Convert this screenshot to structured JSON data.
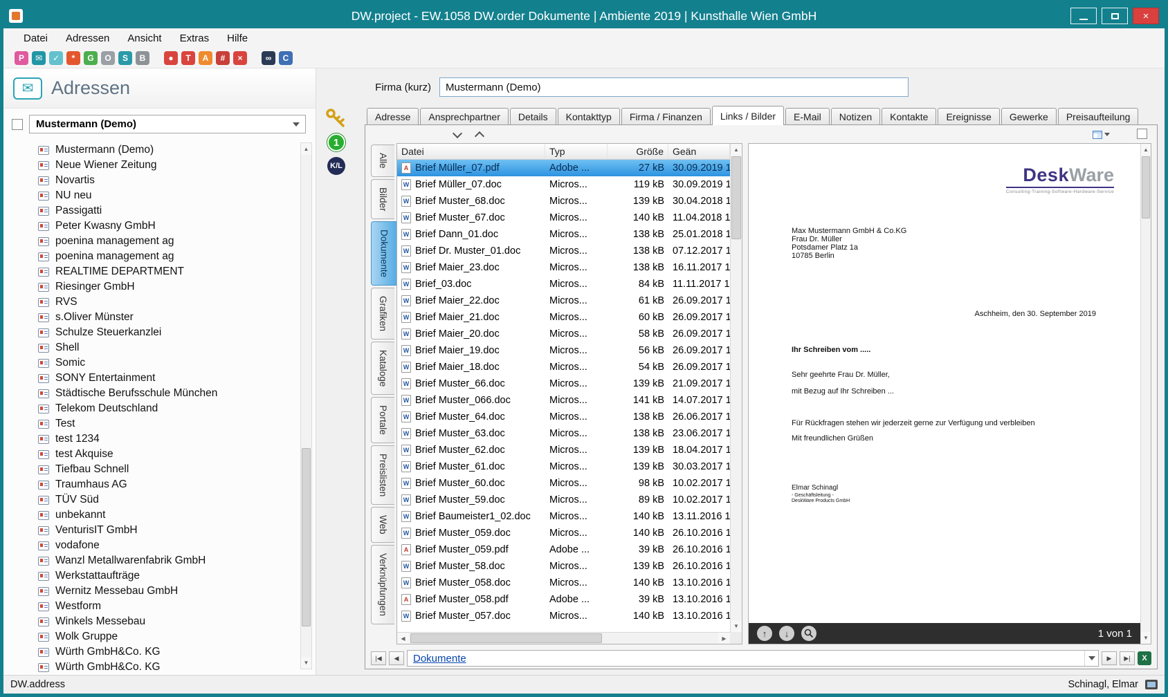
{
  "window": {
    "title": "DW.project - EW.1058 DW.order Dokumente | Ambiente 2019 | Kunsthalle Wien GmbH",
    "close_glyph": "×"
  },
  "menubar": {
    "items": [
      "Datei",
      "Adressen",
      "Ansicht",
      "Extras",
      "Hilfe"
    ]
  },
  "toolbar": {
    "icons": [
      {
        "name": "person-card-icon",
        "bg": "#df5a9e",
        "glyph": "P",
        "gap": false
      },
      {
        "name": "envelope-icon",
        "bg": "#2196a6",
        "glyph": "✉",
        "gap": false
      },
      {
        "name": "mail-check-icon",
        "bg": "#63c1cd",
        "glyph": "✓",
        "gap": false
      },
      {
        "name": "star-icon",
        "bg": "#e4572e",
        "glyph": "*",
        "gap": false
      },
      {
        "name": "plant-icon",
        "bg": "#4cae4f",
        "glyph": "G",
        "gap": false
      },
      {
        "name": "camera-icon",
        "bg": "#9aa0a6",
        "glyph": "O",
        "gap": false
      },
      {
        "name": "shield-icon",
        "bg": "#2a9aa8",
        "glyph": "S",
        "gap": false
      },
      {
        "name": "archive-icon",
        "bg": "#8d9297",
        "glyph": "B",
        "gap": false
      },
      {
        "name": "record-icon",
        "bg": "#d8453e",
        "glyph": "●",
        "gap": true
      },
      {
        "name": "tag-icon",
        "bg": "#d8453e",
        "glyph": "T",
        "gap": false
      },
      {
        "name": "contact-icon",
        "bg": "#ef8b2e",
        "glyph": "A",
        "gap": false
      },
      {
        "name": "table-icon",
        "bg": "#c8403a",
        "glyph": "#",
        "gap": false
      },
      {
        "name": "delete-icon",
        "bg": "#d8453e",
        "glyph": "×",
        "gap": false
      },
      {
        "name": "glasses-icon",
        "bg": "#2b3a55",
        "glyph": "∞",
        "gap": true
      },
      {
        "name": "chat-icon",
        "bg": "#3f6fb5",
        "glyph": "C",
        "gap": false
      }
    ]
  },
  "sidebar": {
    "title": "Adressen",
    "filter_value": "Mustermann (Demo)",
    "tree": [
      "Mustermann (Demo)",
      "Neue Wiener Zeitung",
      "Novartis",
      "NU neu",
      "Passigatti",
      "Peter Kwasny GmbH",
      "poenina management ag",
      "poenina management ag",
      "REALTIME DEPARTMENT",
      "Riesinger GmbH",
      "RVS",
      "s.Oliver Münster",
      "Schulze Steuerkanzlei",
      "Shell",
      "Somic",
      "SONY Entertainment",
      "Städtische Berufsschule München",
      "Telekom Deutschland",
      "Test",
      "test 1234",
      "test Akquise",
      "Tiefbau Schnell",
      "Traumhaus AG",
      "TÜV Süd",
      "unbekannt",
      "VenturisIT GmbH",
      "vodafone",
      "Wanzl Metallwarenfabrik GmbH",
      "Werkstattaufträge",
      "Wernitz Messebau GmbH",
      "Westform",
      "Winkels Messebau",
      "Wolk Gruppe",
      "Würth GmbH&Co. KG",
      "Würth GmbH&Co. KG"
    ]
  },
  "middle": {
    "count_badge": "1",
    "kl_badge": "K/L"
  },
  "detail": {
    "firma_label": "Firma (kurz)",
    "firma_value": "Mustermann (Demo)",
    "tabs": [
      "Adresse",
      "Ansprechpartner",
      "Details",
      "Kontakttyp",
      "Firma / Finanzen",
      "Links / Bilder",
      "E-Mail",
      "Notizen",
      "Kontakte",
      "Ereignisse",
      "Gewerke",
      "Preisaufteilung"
    ],
    "active_tab": "Links / Bilder",
    "vtabs": [
      "Alle",
      "Bilder",
      "Dokumente",
      "Grafiken",
      "Kataloge",
      "Portale",
      "Preislisten",
      "Web",
      "Verknüpfungen"
    ],
    "active_vtab": "Dokumente",
    "files": {
      "columns": [
        "Datei",
        "Typ",
        "Größe",
        "Geän"
      ],
      "rows": [
        {
          "name": "Brief Müller_07.pdf",
          "type": "Adobe ...",
          "size": "27 kB",
          "date": "30.09.2019 1",
          "icon": "pdf",
          "selected": true
        },
        {
          "name": "Brief Müller_07.doc",
          "type": "Micros...",
          "size": "119 kB",
          "date": "30.09.2019 1",
          "icon": "doc",
          "selected": false
        },
        {
          "name": "Brief Muster_68.doc",
          "type": "Micros...",
          "size": "139 kB",
          "date": "30.04.2018 1",
          "icon": "doc",
          "selected": false
        },
        {
          "name": "Brief Muster_67.doc",
          "type": "Micros...",
          "size": "140 kB",
          "date": "11.04.2018 1",
          "icon": "doc",
          "selected": false
        },
        {
          "name": "Brief Dann_01.doc",
          "type": "Micros...",
          "size": "138 kB",
          "date": "25.01.2018 1",
          "icon": "doc",
          "selected": false
        },
        {
          "name": "Brief Dr. Muster_01.doc",
          "type": "Micros...",
          "size": "138 kB",
          "date": "07.12.2017 1",
          "icon": "doc",
          "selected": false
        },
        {
          "name": "Brief Maier_23.doc",
          "type": "Micros...",
          "size": "138 kB",
          "date": "16.11.2017 1",
          "icon": "doc",
          "selected": false
        },
        {
          "name": "Brief_03.doc",
          "type": "Micros...",
          "size": "84 kB",
          "date": "11.11.2017 1",
          "icon": "doc",
          "selected": false
        },
        {
          "name": "Brief Maier_22.doc",
          "type": "Micros...",
          "size": "61 kB",
          "date": "26.09.2017 1",
          "icon": "doc",
          "selected": false
        },
        {
          "name": "Brief Maier_21.doc",
          "type": "Micros...",
          "size": "60 kB",
          "date": "26.09.2017 1",
          "icon": "doc",
          "selected": false
        },
        {
          "name": "Brief Maier_20.doc",
          "type": "Micros...",
          "size": "58 kB",
          "date": "26.09.2017 1",
          "icon": "doc",
          "selected": false
        },
        {
          "name": "Brief Maier_19.doc",
          "type": "Micros...",
          "size": "56 kB",
          "date": "26.09.2017 1",
          "icon": "doc",
          "selected": false
        },
        {
          "name": "Brief Maier_18.doc",
          "type": "Micros...",
          "size": "54 kB",
          "date": "26.09.2017 1",
          "icon": "doc",
          "selected": false
        },
        {
          "name": "Brief Muster_66.doc",
          "type": "Micros...",
          "size": "139 kB",
          "date": "21.09.2017 1",
          "icon": "doc",
          "selected": false
        },
        {
          "name": "Brief Muster_066.doc",
          "type": "Micros...",
          "size": "141 kB",
          "date": "14.07.2017 1",
          "icon": "doc",
          "selected": false
        },
        {
          "name": "Brief Muster_64.doc",
          "type": "Micros...",
          "size": "138 kB",
          "date": "26.06.2017 1",
          "icon": "doc",
          "selected": false
        },
        {
          "name": "Brief Muster_63.doc",
          "type": "Micros...",
          "size": "138 kB",
          "date": "23.06.2017 1",
          "icon": "doc",
          "selected": false
        },
        {
          "name": "Brief Muster_62.doc",
          "type": "Micros...",
          "size": "139 kB",
          "date": "18.04.2017 1",
          "icon": "doc",
          "selected": false
        },
        {
          "name": "Brief Muster_61.doc",
          "type": "Micros...",
          "size": "139 kB",
          "date": "30.03.2017 1",
          "icon": "doc",
          "selected": false
        },
        {
          "name": "Brief Muster_60.doc",
          "type": "Micros...",
          "size": "98 kB",
          "date": "10.02.2017 1",
          "icon": "doc",
          "selected": false
        },
        {
          "name": "Brief Muster_59.doc",
          "type": "Micros...",
          "size": "89 kB",
          "date": "10.02.2017 1",
          "icon": "doc",
          "selected": false
        },
        {
          "name": "Brief Baumeister1_02.doc",
          "type": "Micros...",
          "size": "140 kB",
          "date": "13.11.2016 1",
          "icon": "doc",
          "selected": false
        },
        {
          "name": "Brief Muster_059.doc",
          "type": "Micros...",
          "size": "140 kB",
          "date": "26.10.2016 1",
          "icon": "doc",
          "selected": false
        },
        {
          "name": "Brief Muster_059.pdf",
          "type": "Adobe ...",
          "size": "39 kB",
          "date": "26.10.2016 1",
          "icon": "pdf",
          "selected": false
        },
        {
          "name": "Brief Muster_58.doc",
          "type": "Micros...",
          "size": "139 kB",
          "date": "26.10.2016 1",
          "icon": "doc",
          "selected": false
        },
        {
          "name": "Brief Muster_058.doc",
          "type": "Micros...",
          "size": "140 kB",
          "date": "13.10.2016 1",
          "icon": "doc",
          "selected": false
        },
        {
          "name": "Brief Muster_058.pdf",
          "type": "Adobe ...",
          "size": "39 kB",
          "date": "13.10.2016 1",
          "icon": "pdf",
          "selected": false
        },
        {
          "name": "Brief Muster_057.doc",
          "type": "Micros...",
          "size": "140 kB",
          "date": "13.10.2016 1",
          "icon": "doc",
          "selected": false
        }
      ]
    },
    "preview": {
      "logo_bold": "Desk",
      "logo_light": "Ware",
      "logo_tagline": "Consulting-Training-Software-Hardware-Service",
      "address_lines": [
        "Max Mustermann GmbH & Co.KG",
        "Frau Dr. Müller",
        "Potsdamer Platz 1a",
        "10785 Berlin"
      ],
      "date_line": "Aschheim, den 30. September 2019",
      "body_lines": [
        "Ihr Schreiben vom .....",
        "Sehr geehrte Frau Dr. Müller,",
        "mit Bezug auf Ihr Schreiben ...",
        "Für Rückfragen stehen wir jederzeit gerne zur Verfügung und verbleiben",
        "Mit freundlichen Grüßen"
      ],
      "signature_lines": [
        "Elmar Schinagl",
        "- Geschäftsleitung -",
        "DeskWare Products GmbH"
      ],
      "page_indicator": "1 von 1"
    },
    "recnav": {
      "value": "Dokumente"
    }
  },
  "statusbar": {
    "left": "DW.address",
    "right": "Schinagl, Elmar"
  }
}
